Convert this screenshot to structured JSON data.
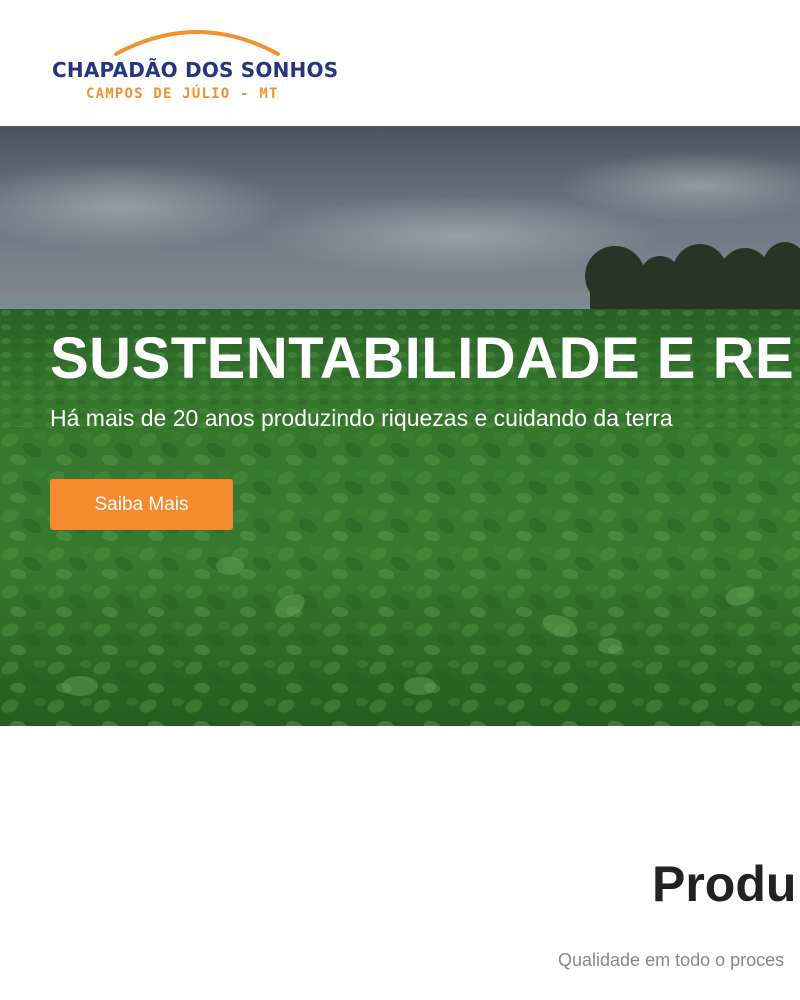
{
  "header": {
    "logo": {
      "title": "CHAPADÃO DOS SONHOS",
      "subtitle": "CAMPOS DE JÚLIO - MT"
    }
  },
  "hero": {
    "title": "SUSTENTABILIDADE E RE",
    "subtitle": "Há mais de 20 anos produzindo riquezas e cuidando da terra",
    "button_label": "Saiba Mais"
  },
  "products_section": {
    "title": "Produ",
    "subtitle": "Qualidade em todo o proces"
  },
  "colors": {
    "brand_blue": "#263580",
    "brand_orange": "#f2922e",
    "button_orange": "#f58a2e",
    "title_dark": "#222222",
    "subtitle_gray": "#888888"
  }
}
